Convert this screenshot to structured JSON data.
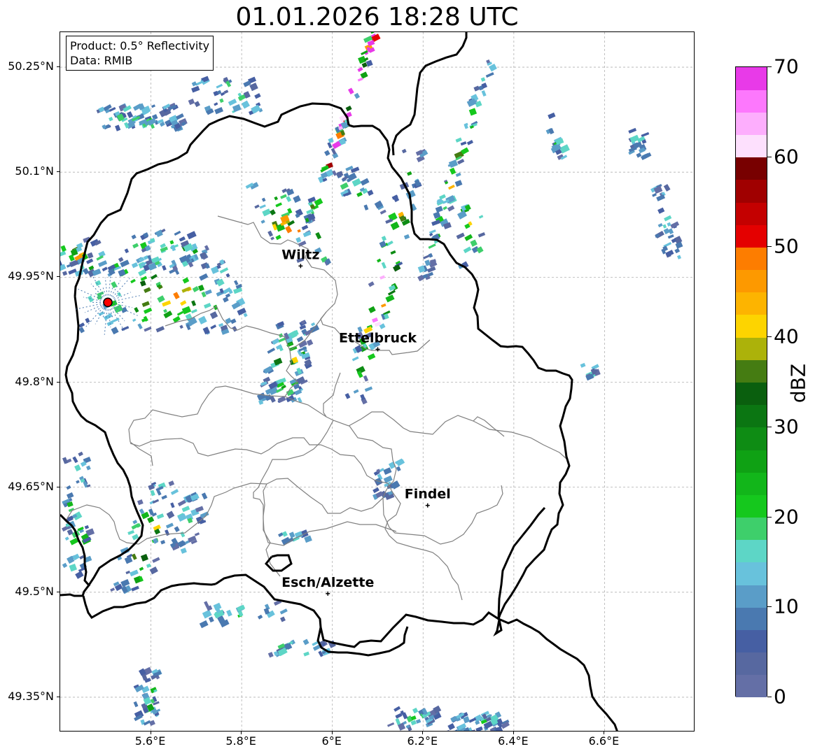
{
  "title": "01.01.2026 18:28 UTC",
  "info": {
    "product": "Product: 0.5° Reflectivity",
    "source": "Data: RMIB"
  },
  "map_extent": {
    "lon": [
      5.4,
      6.8
    ],
    "lat": [
      49.3,
      50.3
    ]
  },
  "y_ticks": [
    {
      "label": "50.25°N",
      "lat": 50.25
    },
    {
      "label": "50.1°N",
      "lat": 50.1
    },
    {
      "label": "49.95°N",
      "lat": 49.95
    },
    {
      "label": "49.8°N",
      "lat": 49.8
    },
    {
      "label": "49.65°N",
      "lat": 49.65
    },
    {
      "label": "49.5°N",
      "lat": 49.5
    },
    {
      "label": "49.35°N",
      "lat": 49.35
    }
  ],
  "x_ticks": [
    {
      "label": "5.6°E",
      "lon": 5.6
    },
    {
      "label": "5.8°E",
      "lon": 5.8
    },
    {
      "label": "6°E",
      "lon": 6.0
    },
    {
      "label": "6.2°E",
      "lon": 6.2
    },
    {
      "label": "6.4°E",
      "lon": 6.4
    },
    {
      "label": "6.6°E",
      "lon": 6.6
    }
  ],
  "cities": [
    {
      "name": "Wiltz",
      "lon": 5.93,
      "lat": 49.966
    },
    {
      "name": "Ettelbruck",
      "lon": 6.1,
      "lat": 49.847
    },
    {
      "name": "Findel",
      "lon": 6.21,
      "lat": 49.624
    },
    {
      "name": "Esch/Alzette",
      "lon": 5.99,
      "lat": 49.498
    }
  ],
  "radar_site": {
    "lon": 5.505,
    "lat": 49.914,
    "color": "#ff0000"
  },
  "colorbar": {
    "label": "dBZ",
    "min": 0,
    "max": 70,
    "ticks": [
      "0",
      "10",
      "20",
      "30",
      "40",
      "50",
      "60",
      "70"
    ],
    "colors": [
      "#646fa6",
      "#5768a0",
      "#465fa3",
      "#4a79b0",
      "#5a9dc8",
      "#68c2dc",
      "#5dd6c6",
      "#3ecf6b",
      "#15c81d",
      "#12b61a",
      "#0fa114",
      "#0e8c14",
      "#0b7612",
      "#0a5f0e",
      "#457c12",
      "#acb20a",
      "#fdd400",
      "#fdb400",
      "#fd9900",
      "#fd7d00",
      "#e40000",
      "#c40000",
      "#a00000",
      "#780000",
      "#fde0fd",
      "#fdaefd",
      "#fd78fd",
      "#e83ae8"
    ]
  },
  "colors": {
    "border": "#000000",
    "canton_border": "#808080",
    "grid": "#b0b0b0"
  }
}
